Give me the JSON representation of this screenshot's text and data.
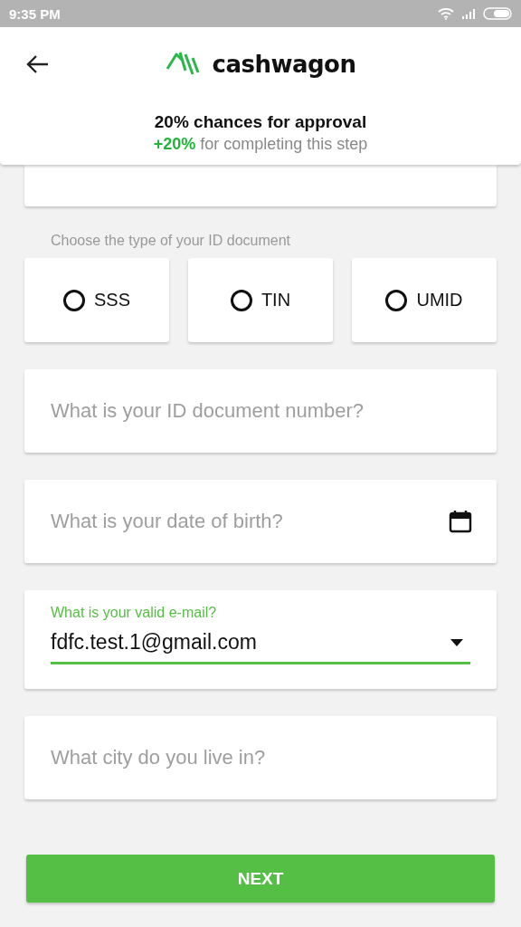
{
  "status_bar": {
    "time": "9:35 PM"
  },
  "header": {
    "logo_text": "cashwagon"
  },
  "banner": {
    "title": "20% chances for approval",
    "subtitle": "**+20%** for completing this step"
  },
  "id_type": {
    "label": "Choose the type of your ID document",
    "options": [
      {
        "label": "SSS",
        "selected": false
      },
      {
        "label": "TIN",
        "selected": false
      },
      {
        "label": "UMID",
        "selected": false
      }
    ]
  },
  "fields": [
    {
      "kind": "text",
      "placeholder": "What is your ID document number?"
    },
    {
      "kind": "date",
      "placeholder": "What is your date of birth?"
    },
    {
      "kind": "select",
      "label": "What is your valid e-mail?",
      "value": "fdfc.test.1@gmail.com",
      "focused": true
    },
    {
      "kind": "text",
      "placeholder": "What city do you live in?"
    }
  ],
  "next_button": "NEXT"
}
